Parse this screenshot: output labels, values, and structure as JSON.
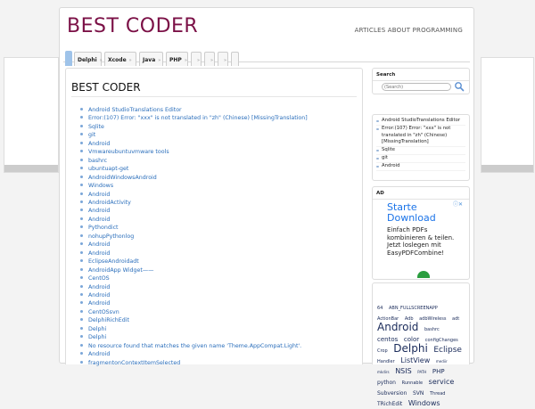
{
  "site": {
    "title": "BEST CODER",
    "tagline": "ARTICLES ABOUT PROGRAMMING"
  },
  "nav": {
    "tabs": [
      {
        "label": "Delphi",
        "close": "»"
      },
      {
        "label": "Xcode",
        "close": "»"
      },
      {
        "label": "Java",
        "close": "»"
      },
      {
        "label": "PHP",
        "close": "»"
      },
      {
        "label": "",
        "close": "»"
      },
      {
        "label": "",
        "close": "»"
      },
      {
        "label": "",
        "close": "»"
      },
      {
        "label": "",
        "close": ""
      }
    ]
  },
  "main": {
    "title": "BEST CODER",
    "posts": [
      "Android StudioTranslations Editor",
      "Error:(107) Error: \"xxx\" is not translated in \"zh\" (Chinese) [MissingTranslation]",
      "Sqlite",
      "git",
      "Android",
      "Vmwareubuntuvmware tools",
      "bashrc",
      "ubuntuapt-get",
      "AndroidWindowsAndroid",
      "Windows",
      "Android",
      "AndroidActivity",
      "Android",
      "Android",
      "Pythondict",
      "nohupPythonlog",
      "Android",
      "Android",
      "EclipseAndroidadt",
      "AndroidApp Widget——",
      "CentOS",
      "Android",
      "Android",
      "Android",
      "CentOSsvn",
      "DelphiRichEdit",
      "Delphi",
      "Delphi",
      "No resource found that matches the given name 'Theme.AppCompat.Light'.",
      "Android",
      "fragmentonContextItemSelected"
    ]
  },
  "sidebar": {
    "search": {
      "title": "Search",
      "placeholder": "(Search)"
    },
    "recent": {
      "items": [
        "Android StudioTranslations Editor",
        "Error:(107) Error: \"xxx\" is not translated in \"zh\" (Chinese) [MissingTranslation]",
        "Sqlite",
        "git",
        "Android"
      ]
    },
    "ad": {
      "title": "AD",
      "headline": "Starte Download",
      "body": "Einfach PDFs kombinieren & teilen. Jetzt loslegen mit EasyPDFCombine!",
      "close": "ⓘ✕"
    },
    "tags": [
      {
        "text": "64",
        "size": 5
      },
      {
        "text": "ABN_FULLSCREENAPP",
        "size": 5
      },
      {
        "text": "ActionBar",
        "size": 5
      },
      {
        "text": "Adb",
        "size": 5
      },
      {
        "text": "adbWireless",
        "size": 5
      },
      {
        "text": "adt",
        "size": 5
      },
      {
        "text": "Android",
        "size": 12
      },
      {
        "text": "bashrc",
        "size": 5
      },
      {
        "text": "centos",
        "size": 7
      },
      {
        "text": "color",
        "size": 7
      },
      {
        "text": "configChanges",
        "size": 5
      },
      {
        "text": "Crop",
        "size": 5
      },
      {
        "text": "Delphi",
        "size": 12
      },
      {
        "text": "Eclipse",
        "size": 9
      },
      {
        "text": "Handler",
        "size": 5
      },
      {
        "text": "ListView",
        "size": 8
      },
      {
        "text": "mediir",
        "size": 4
      },
      {
        "text": "mkdirs",
        "size": 4
      },
      {
        "text": "NSIS",
        "size": 8
      },
      {
        "text": "PATH",
        "size": 4
      },
      {
        "text": "PHP",
        "size": 7
      },
      {
        "text": "python",
        "size": 6
      },
      {
        "text": "Runnable",
        "size": 5
      },
      {
        "text": "service",
        "size": 8
      },
      {
        "text": "Subversion",
        "size": 6
      },
      {
        "text": "SVN",
        "size": 6
      },
      {
        "text": "Thread",
        "size": 5
      },
      {
        "text": "TRichEdit",
        "size": 6
      },
      {
        "text": "Windows",
        "size": 8
      }
    ]
  },
  "colors": {
    "brand": "#7b1046",
    "link": "#2a6ebb",
    "ad_blue": "#1a73e8",
    "ad_green": "#2a9d3f"
  }
}
